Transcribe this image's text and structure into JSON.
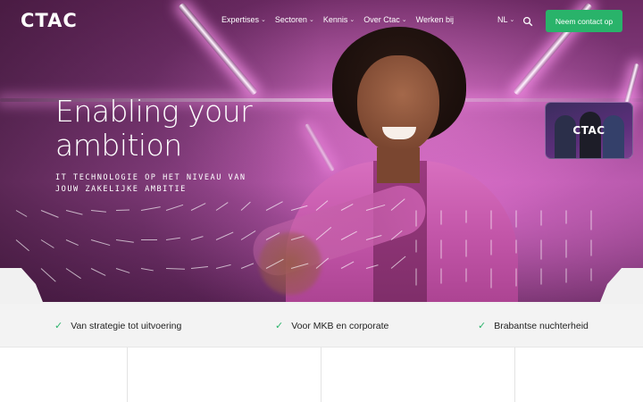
{
  "brand": {
    "logo_text": "CTAC",
    "accent_color": "#29b36a"
  },
  "nav": {
    "items": [
      {
        "label": "Expertises",
        "has_dropdown": true
      },
      {
        "label": "Sectoren",
        "has_dropdown": true
      },
      {
        "label": "Kennis",
        "has_dropdown": true
      },
      {
        "label": "Over Ctac",
        "has_dropdown": true
      },
      {
        "label": "Werken bij",
        "has_dropdown": false
      }
    ],
    "language": "NL",
    "search_icon": "search-icon",
    "cta_label": "Neem contact op"
  },
  "hero": {
    "headline_line1": "Enabling your",
    "headline_line2": "ambition",
    "subline_line1": "IT TECHNOLOGIE OP HET NIVEAU VAN",
    "subline_line2": "JOUW ZAKELIJKE AMBITIE",
    "video_card_text": "CTAC"
  },
  "features": [
    {
      "label": "Van strategie tot uitvoering",
      "icon": "check-icon"
    },
    {
      "label": "Voor MKB en corporate",
      "icon": "check-icon"
    },
    {
      "label": "Brabantse nuchterheid",
      "icon": "check-icon"
    }
  ]
}
